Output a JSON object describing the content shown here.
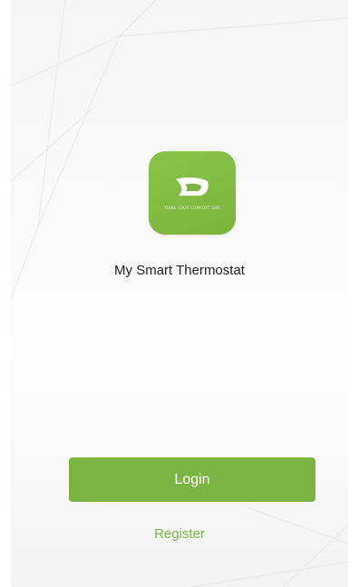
{
  "app": {
    "name": "My Smart Thermostat",
    "icon": "thermostat-leaf-logo",
    "icon_tagline": "THINK YOUR COMFORT LIFE"
  },
  "actions": {
    "login_label": "Login",
    "register_label": "Register"
  },
  "colors": {
    "accent": "#7cb342",
    "icon_background": "#82bc44",
    "text": "#222222"
  }
}
